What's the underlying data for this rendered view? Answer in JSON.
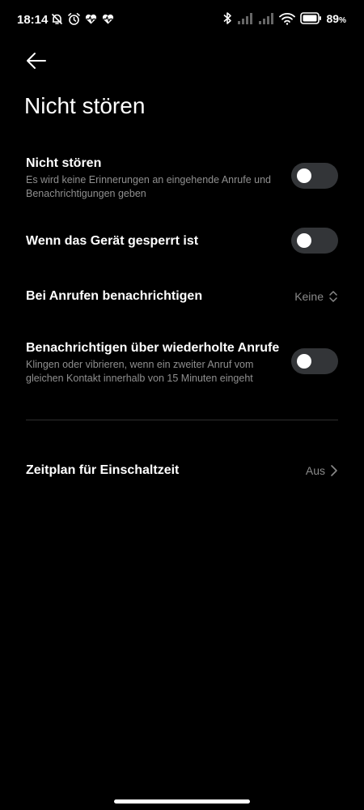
{
  "status_bar": {
    "time": "18:14",
    "battery": "89"
  },
  "header": {
    "title": "Nicht stören"
  },
  "settings": {
    "dnd": {
      "title": "Nicht stören",
      "description": "Es wird keine Erinnerungen an eingehende Anrufe und Benachrichtigungen geben",
      "enabled": false
    },
    "locked": {
      "title": "Wenn das Gerät gesperrt ist",
      "enabled": false
    },
    "calls": {
      "title": "Bei Anrufen benachrichtigen",
      "value": "Keine"
    },
    "repeated": {
      "title": "Benachrichtigen über wiederholte Anrufe",
      "description": "Klingen oder vibrieren, wenn ein zweiter Anruf vom gleichen Kontakt innerhalb von 15 Minuten eingeht",
      "enabled": false
    },
    "schedule": {
      "title": "Zeitplan für Einschaltzeit",
      "value": "Aus"
    }
  },
  "colors": {
    "background": "#000000",
    "toggle_off_track": "#333538",
    "secondary_text": "#8f8f8f"
  }
}
